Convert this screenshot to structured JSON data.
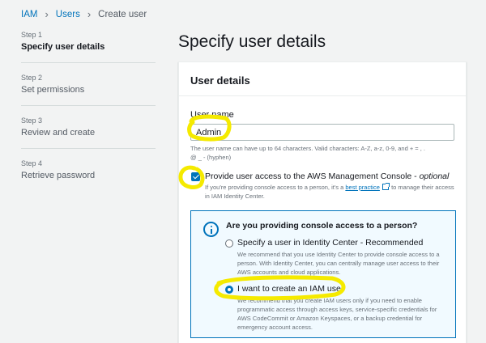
{
  "breadcrumb": {
    "root": "IAM",
    "section": "Users",
    "current": "Create user"
  },
  "steps": [
    {
      "number": "Step 1",
      "label": "Specify user details"
    },
    {
      "number": "Step 2",
      "label": "Set permissions"
    },
    {
      "number": "Step 3",
      "label": "Review and create"
    },
    {
      "number": "Step 4",
      "label": "Retrieve password"
    }
  ],
  "page_title": "Specify user details",
  "panel": {
    "title": "User details",
    "username": {
      "label": "User name",
      "value": "Admin",
      "constraint_line1": "The user name can have up to 64 characters. Valid characters: A-Z, a-z, 0-9, and + = , .",
      "constraint_line2": "@ _ - (hyphen)"
    },
    "console_access": {
      "label": "Provide user access to the AWS Management Console - ",
      "optional": "optional",
      "checked": true,
      "desc_before": "If you're providing console access to a person, it's a ",
      "desc_link": "best practice",
      "desc_after": " to manage their access in IAM Identity Center."
    },
    "info": {
      "title": "Are you providing console access to a person?",
      "option1_label": "Specify a user in Identity Center - Recommended",
      "option1_desc": "We recommend that you use Identity Center to provide console access to a person. With Identity Center, you can centrally manage user access to their AWS accounts and cloud applications.",
      "option2_label": "I want to create an IAM user",
      "option2_desc": "We recommend that you create IAM users only if you need to enable programmatic access through access keys, service-specific credentials for AWS CodeCommit or Amazon Keyspaces, or a backup credential for emergency account access.",
      "selected": "option2"
    }
  },
  "colors": {
    "link": "#0073bb",
    "highlight": "#f5ea00",
    "info_bg": "#f1faff"
  },
  "icons": [
    "chevron-right-icon",
    "checkbox-checked-icon",
    "external-link-icon",
    "info-icon"
  ]
}
